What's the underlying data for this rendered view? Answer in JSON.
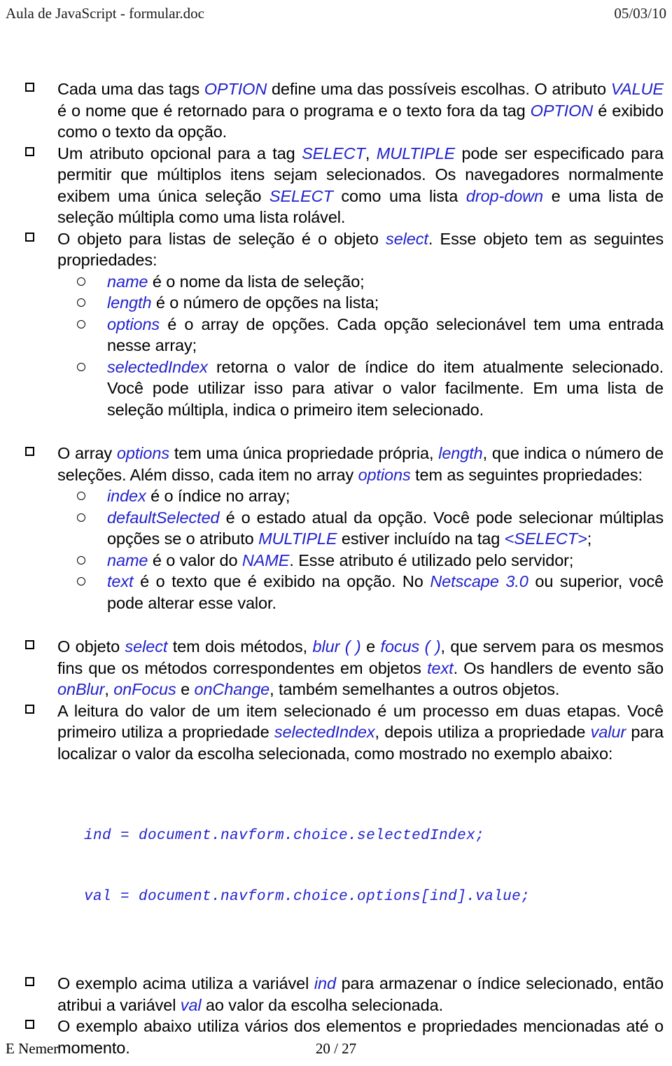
{
  "header": {
    "document_title": "Aula de JavaScript - formular.doc",
    "date": "05/03/10"
  },
  "footer": {
    "author": "E Nemer",
    "page_indicator": "20 / 27"
  },
  "colors": {
    "keyword_blue": "#2222cc",
    "body_text": "#000000",
    "page_background": "#ffffff"
  },
  "content": {
    "bullet_marker": "hollow-square",
    "subbullet_marker": "hollow-circle",
    "b1_option": {
      "p1": "Cada uma das tags ",
      "kw1": "OPTION",
      "p2": " define uma das possíveis escolhas. O atributo ",
      "kw2": "VALUE",
      "p3": " é o nome que é retornado para o programa e o texto fora da tag ",
      "kw3": "OPTION",
      "p4": " é exibido como o texto da opção."
    },
    "b1_multiple": {
      "p1": "Um atributo opcional para a tag ",
      "kw1": "SELECT",
      "p2": ", ",
      "kw2": "MULTIPLE",
      "p3": " pode ser especificado para permitir que múltiplos itens sejam selecionados. Os navegadores normalmente exibem uma única seleção ",
      "kw3": "SELECT",
      "p4": " como uma lista ",
      "kw4": "drop-down",
      "p5": " e uma lista de seleção múltipla como uma lista rolável."
    },
    "b1_select_object": {
      "p1": "O objeto para listas de seleção é o objeto ",
      "kw1": "select",
      "p2": ". Esse objeto tem as seguintes propriedades:"
    },
    "b2_name": {
      "kw1": "name",
      "p1": " é o nome da lista de seleção;"
    },
    "b2_length": {
      "kw1": "length",
      "p1": " é o número de opções na lista;"
    },
    "b2_options": {
      "kw1": "options",
      "p1": " é o array de opções. Cada opção selecionável tem uma entrada nesse array;"
    },
    "b2_selectedindex": {
      "kw1": "selectedIndex",
      "p1": " retorna o valor de índice do item atualmente selecionado. Você pode utilizar isso para ativar o valor facilmente. Em uma lista de seleção múltipla, indica o primeiro item selecionado."
    },
    "b1_options_array": {
      "p1": "O array ",
      "kw1": "options",
      "p2": " tem uma única propriedade própria, ",
      "kw2": "length",
      "p3": ", que indica o número de seleções. Além disso, cada item no array ",
      "kw3": "options",
      "p4": " tem as seguintes propriedades:"
    },
    "b2_index": {
      "kw1": "index",
      "p1": " é o índice no array;"
    },
    "b2_defaultselected": {
      "kw1": "defaultSelected",
      "p1": " é o estado atual da opção. Você pode selecionar múltiplas opções se o atributo ",
      "kw2": "MULTIPLE",
      "p2": " estiver incluído na tag ",
      "kw3": "<SELECT>",
      "p3": ";"
    },
    "b2_name_value": {
      "kw1": "name",
      "p1": " é o valor do ",
      "kw2": "NAME",
      "p2": ". Esse atributo é utilizado pelo servidor;"
    },
    "b2_text": {
      "kw1": "text",
      "p1": " é o texto que é exibido na opção. No ",
      "kw2": "Netscape 3.0",
      "p2": " ou superior, você pode alterar esse valor."
    },
    "b1_methods": {
      "p1": "O objeto ",
      "kw1": "select",
      "p2": " tem dois métodos, ",
      "kw2": "blur ( )",
      "p3": " e ",
      "kw3": "focus ( )",
      "p4": ", que servem para os mesmos fins que os métodos correspondentes em objetos ",
      "kw4": "text",
      "p5": ". Os handlers de evento são ",
      "kw5": "onBlur",
      "p6": ", ",
      "kw6": "onFocus",
      "p7": " e ",
      "kw7": "onChange",
      "p8": ", também semelhantes a outros objetos."
    },
    "b1_reading": {
      "p1": "A leitura do valor de um item selecionado é um processo em duas etapas. Você primeiro utiliza a propriedade ",
      "kw1": "selectedIndex",
      "p2": ", depois utiliza a propriedade ",
      "kw2": "valur",
      "p3": " para localizar o valor da escolha selecionada, como mostrado no exemplo abaixo:"
    },
    "code_sample": {
      "line1": "ind = document.navform.choice.selectedIndex;",
      "line2": "val = document.navform.choice.options[ind].value;"
    },
    "b1_example_above": {
      "p1": "O exemplo acima utiliza a variável ",
      "kw1": "ind",
      "p2": " para armazenar o índice selecionado, então atribui a variável ",
      "kw2": "val",
      "p3": " ao valor da escolha selecionada."
    },
    "b1_example_below": {
      "p1": "O exemplo abaixo utiliza vários dos elementos e propriedades mencionadas até o momento."
    }
  }
}
